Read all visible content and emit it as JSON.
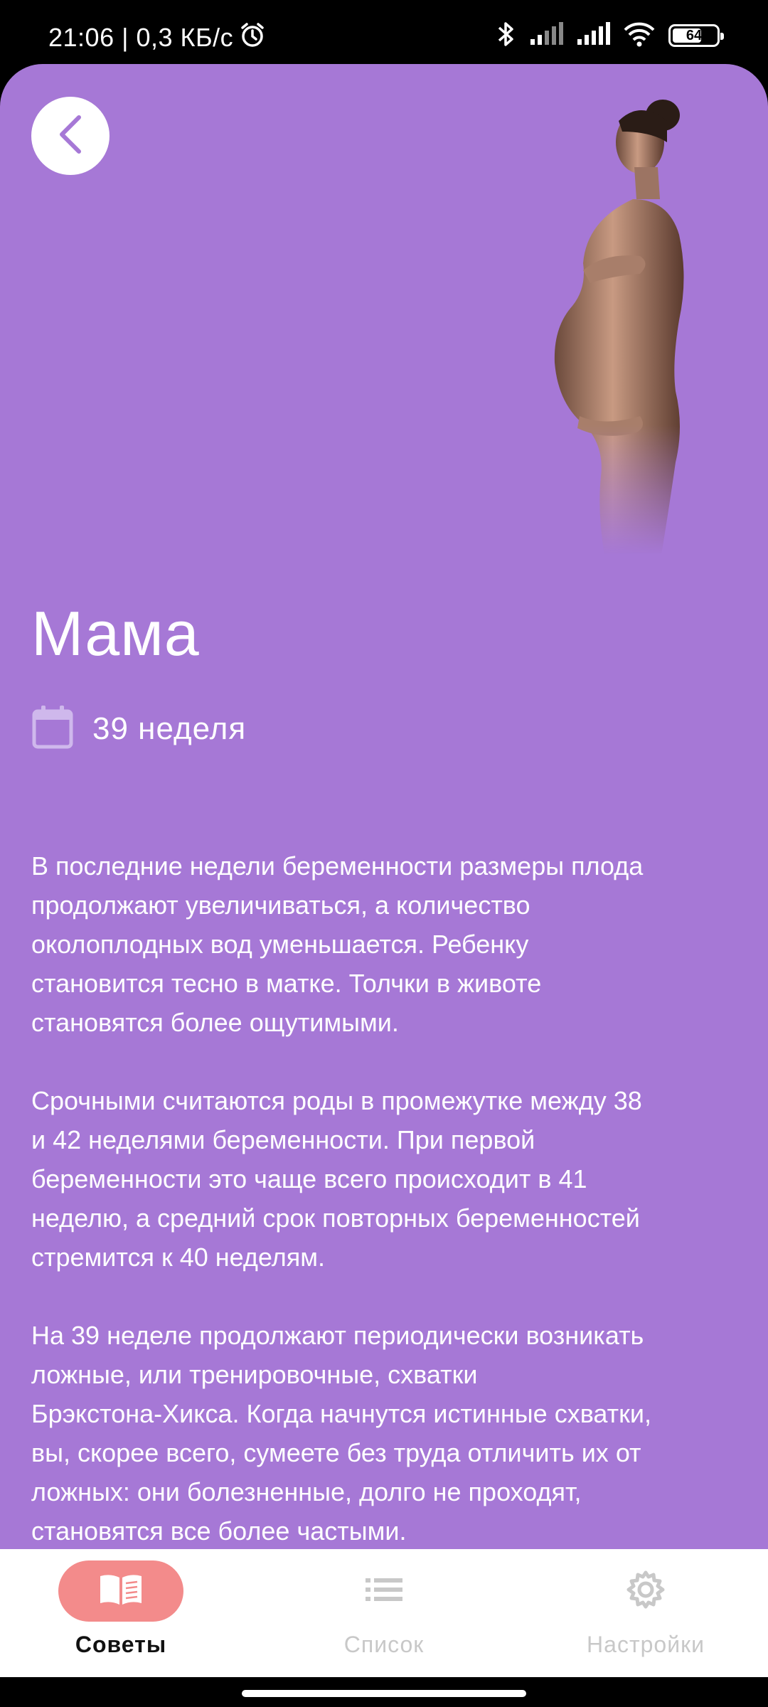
{
  "status_bar": {
    "time_speed": "21:06 | 0,3 КБ/с",
    "battery": "64",
    "icons": [
      "alarm-icon",
      "bluetooth-icon",
      "signal-icon",
      "signal-icon",
      "wifi-icon",
      "battery-icon"
    ]
  },
  "header": {
    "back_icon": "chevron-left-icon",
    "hero_image": "pregnant-woman-silhouette"
  },
  "content": {
    "title": "Мама",
    "week_icon": "calendar-icon",
    "week_label": "39 неделя",
    "article": "В последние недели беременности размеры плода\nпродолжают увеличиваться, а количество\nоколоплодных вод уменьшается. Ребенку\nстановится тесно в матке. Толчки в животе\nстановятся более ощутимыми.\n\n Срочными считаются роды в промежутке между 38\nи 42 неделями беременности. При первой\nбеременности это чаще всего происходит в 41\nнеделю, а средний срок повторных беременностей\nстремится к 40 неделям.\n\n На 39 неделе продолжают периодически возникать\nложные, или тренировочные, схватки\nБрэкстона-Хикса. Когда начнутся истинные схватки,\nвы, скорее всего, сумеете без труда отличить их от\nложных: они болезненные, долго не проходят,\nстановятся все более частыми.\n\n Плод опускается ниже, поэтому мама чувствует"
  },
  "bottom_nav": {
    "items": [
      {
        "label": "Советы",
        "icon": "book-icon",
        "active": true
      },
      {
        "label": "Список",
        "icon": "list-icon",
        "active": false
      },
      {
        "label": "Настройки",
        "icon": "gear-icon",
        "active": false
      }
    ]
  },
  "colors": {
    "panel_bg": "#a678d6",
    "active_pill": "#f38b8b",
    "inactive_label": "#c8c8c8"
  }
}
